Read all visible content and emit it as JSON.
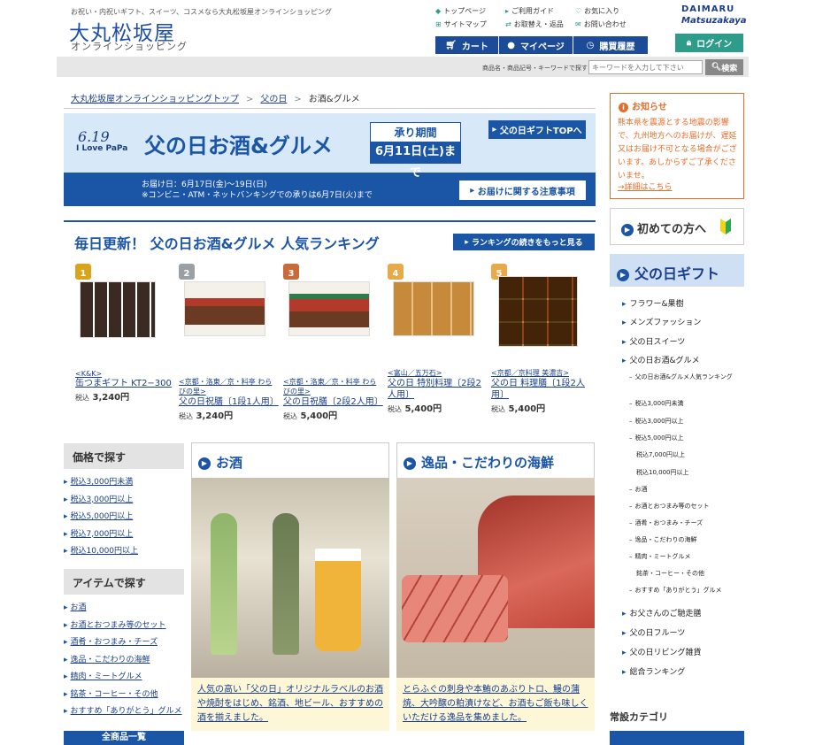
{
  "header": {
    "tagline": "お祝い・内祝いギフト、スイーツ、コスメなら大丸松坂屋オンラインショッピング",
    "logo_main": "大丸松坂屋",
    "logo_sub": "オンラインショッピング",
    "util_links": [
      "トップページ",
      "サイトマップ",
      "ご利用ガイド",
      "お取替え・返品",
      "お気に入り",
      "お問い合わせ"
    ],
    "brand_daimaru": "DAIMARU",
    "brand_matsuzakaya": "Matsuzakaya",
    "cart": "カート",
    "mypage": "マイページ",
    "history": "購買履歴",
    "login": "ログイン",
    "search_label": "商品名・商品記号・キーワードで探す",
    "search_placeholder": "キーワードを入力して下さい",
    "search_button": "検索"
  },
  "breadcrumb": [
    "大丸松坂屋オンラインショッピングトップ",
    "父の日",
    "お酒&グルメ"
  ],
  "banner": {
    "date": "6.19",
    "love": "I Love PaPa",
    "title": "父の日お酒&グルメ",
    "period_label": "承り期間",
    "period_date": "6月11日(土)まで",
    "top_button": "父の日ギフトTOPへ",
    "delivery": "お届け日：6月17日(金)〜19日(日)",
    "payment_note": "※コンビニ・ATM・ネットバンキングでの承りは6月7日(火)まで",
    "note_button": "お届けに関する注意事項"
  },
  "ranking": {
    "title": "毎日更新！ 父の日お酒&グルメ 人気ランキング",
    "more_button": "ランキングの続きをもっと見る",
    "items": [
      {
        "rank": "1",
        "brand": "<K&K>",
        "name": "缶つまギフト KT2−300",
        "tax": "税込",
        "price": "3,240円"
      },
      {
        "rank": "2",
        "brand": "<京都・洛東／京・料亭 わらびの里>",
        "name": "父の日祝膳〔1段1人用〕",
        "tax": "税込",
        "price": "3,240円"
      },
      {
        "rank": "3",
        "brand": "<京都・洛東／京・料亭 わらびの里>",
        "name": "父の日祝膳〔2段2人用〕",
        "tax": "税込",
        "price": "5,400円"
      },
      {
        "rank": "4",
        "brand": "<富山／五万石>",
        "name": "父の日 特別料理〔2段2人用〕",
        "tax": "税込",
        "price": "5,400円"
      },
      {
        "rank": "5",
        "brand": "<京都／京料理 美濃吉>",
        "name": "父の日 料理膳〔1段2人用〕",
        "tax": "税込",
        "price": "5,400円"
      }
    ]
  },
  "left_nav": {
    "price_title": "価格で探す",
    "price_links": [
      "税込3,000円未満",
      "税込3,000円以上",
      "税込5,000円以上",
      "税込7,000円以上",
      "税込10,000円以上"
    ],
    "item_title": "アイテムで探す",
    "item_links": [
      "お酒",
      "お酒とおつまみ等のセット",
      "酒肴・おつまみ・チーズ",
      "逸品・こだわりの海鮮",
      "精肉・ミートグルメ",
      "銘茶・コーヒー・その他",
      "おすすめ「ありがとう」グルメ"
    ],
    "all_button": "全商品一覧"
  },
  "categories": [
    {
      "title": "お酒",
      "desc": "人気の高い「父の日」オリジナルラベルのお酒や焼酎をはじめ、銘酒、地ビール、おすすめの酒を揃えました。"
    },
    {
      "title": "逸品・こだわりの海鮮",
      "desc": "とらふぐの刺身や本鮪のあぶりトロ、鰻の蒲焼、大吟醸の粕漬けなど、お酒もご飯も味しくいただける逸品を集めました。"
    }
  ],
  "notice": {
    "title": "お知らせ",
    "text": "熊本県を震源とする地震の影響で、九州地方へのお届けが、遅延又はお届け不可となる場合がございます。あしからずご了承くださいませ。",
    "link": "→詳細はこちら"
  },
  "right_nav": {
    "first_time": "初めての方へ",
    "gift_title": "父の日ギフト",
    "main_links": [
      "フラワー&果樹",
      "メンズファッション",
      "父の日スイーツ",
      "父の日お酒&グルメ"
    ],
    "sub_links": [
      "父の日お酒&グルメ人気ランキング",
      "税込3,000円未満",
      "税込3,000円以上",
      "税込5,000円以上",
      "税込7,000円以上",
      "税込10,000円以上",
      "お酒",
      "お酒とおつまみ等のセット",
      "酒肴・おつまみ・チーズ",
      "逸品・こだわりの海鮮",
      "精肉・ミートグルメ",
      "銘茶・コーヒー・その他",
      "おすすめ「ありがとう」グルメ"
    ],
    "after_links": [
      "お父さんのご馳走膳",
      "父の日フルーツ",
      "父の日リビング雑貨",
      "総合ランキング"
    ],
    "perm_title": "常設カテゴリ"
  }
}
